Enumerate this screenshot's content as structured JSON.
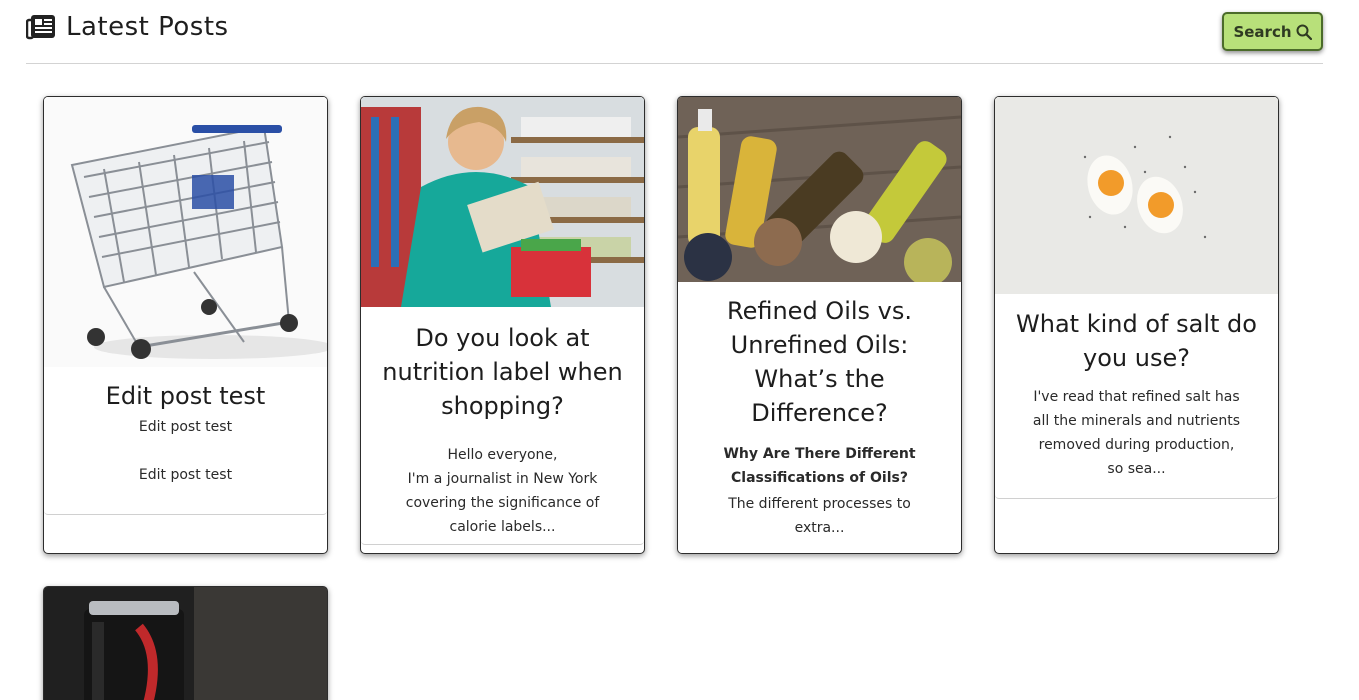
{
  "header": {
    "title": "Latest Posts",
    "search_label": "Search"
  },
  "posts": [
    {
      "title": "Edit post test",
      "lines": [
        "Edit post test",
        "Edit post test"
      ],
      "image": "shopping-cart"
    },
    {
      "title": "Do you look at nutrition label when shopping?",
      "lines": [
        "Hello everyone,",
        "I'm a journalist in New York",
        "covering the significance of",
        "calorie labels..."
      ],
      "image": "woman-reading-label-in-grocery"
    },
    {
      "title": "Refined Oils vs. Unrefined Oils: What’s the Difference?",
      "subtitle": "Why Are There Different Classifications of Oils?",
      "lines": [
        "The different processes to",
        "extra..."
      ],
      "image": "oil-bottles-and-seeds"
    },
    {
      "title": "What kind of salt do you use?",
      "lines": [
        "I've read that refined salt has",
        "all the minerals and nutrients",
        "removed during production,",
        "so sea..."
      ],
      "image": "boiled-eggs-with-salt"
    },
    {
      "title": "",
      "lines": [],
      "image": "soda-can"
    }
  ],
  "colors": {
    "search_bg": "#b8e07a",
    "search_border": "#4b6b2a",
    "card_border": "#2d2d2d"
  }
}
